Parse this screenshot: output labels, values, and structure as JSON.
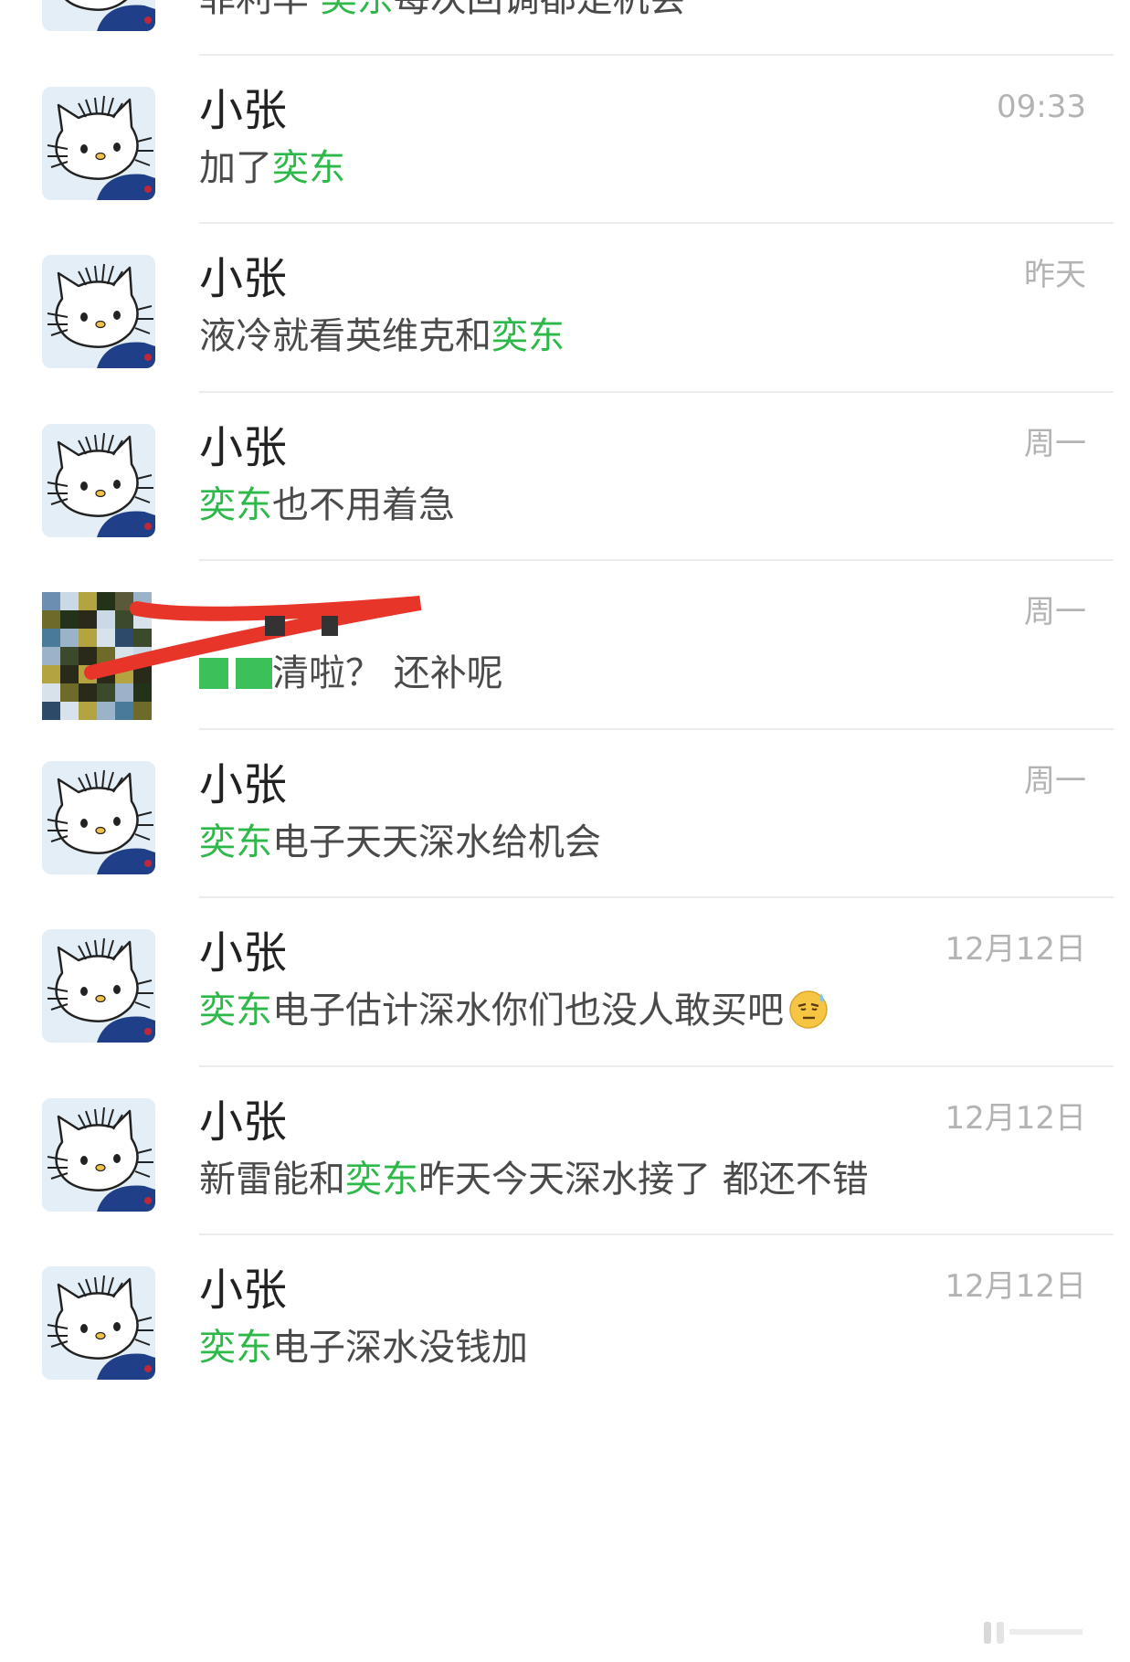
{
  "chats": [
    {
      "name": "",
      "time": "",
      "message": [
        {
          "t": "菲利华  ",
          "hl": false
        },
        {
          "t": "奕东",
          "hl": true
        },
        {
          "t": "每次回调都是机会",
          "hl": false
        }
      ],
      "avatar": "hello-kitty"
    },
    {
      "name": "小张",
      "time": "09:33",
      "message": [
        {
          "t": "加了",
          "hl": false
        },
        {
          "t": "奕东",
          "hl": true
        }
      ],
      "avatar": "hello-kitty"
    },
    {
      "name": "小张",
      "time": "昨天",
      "message": [
        {
          "t": "液冷就看英维克和",
          "hl": false
        },
        {
          "t": "奕东",
          "hl": true
        }
      ],
      "avatar": "hello-kitty"
    },
    {
      "name": "小张",
      "time": "周一",
      "message": [
        {
          "t": "奕东",
          "hl": true
        },
        {
          "t": "也不用着急",
          "hl": false
        }
      ],
      "avatar": "hello-kitty"
    },
    {
      "name": "",
      "time": "周一",
      "message": [
        {
          "t": "清啦？ 还补呢",
          "hl": false
        }
      ],
      "avatar": "mosaic",
      "redacted": true
    },
    {
      "name": "小张",
      "time": "周一",
      "message": [
        {
          "t": "奕东",
          "hl": true
        },
        {
          "t": "电子天天深水给机会",
          "hl": false
        }
      ],
      "avatar": "hello-kitty"
    },
    {
      "name": "小张",
      "time": "12月12日",
      "message": [
        {
          "t": "奕东",
          "hl": true
        },
        {
          "t": "电子估计深水你们也没人敢买吧",
          "hl": false
        }
      ],
      "avatar": "hello-kitty",
      "emoji": "sweat-smile-emoji"
    },
    {
      "name": "小张",
      "time": "12月12日",
      "message": [
        {
          "t": "新雷能和",
          "hl": false
        },
        {
          "t": "奕东",
          "hl": true
        },
        {
          "t": "昨天今天深水接了  都还不错",
          "hl": false
        }
      ],
      "avatar": "hello-kitty"
    },
    {
      "name": "小张",
      "time": "12月12日",
      "message": [
        {
          "t": "奕东",
          "hl": true
        },
        {
          "t": "电子深水没钱加",
          "hl": false
        }
      ],
      "avatar": "hello-kitty"
    }
  ],
  "colors": {
    "highlight": "#2fb84a",
    "time": "#b3b3b3",
    "divider": "#ececec",
    "redline": "#e8352a"
  }
}
